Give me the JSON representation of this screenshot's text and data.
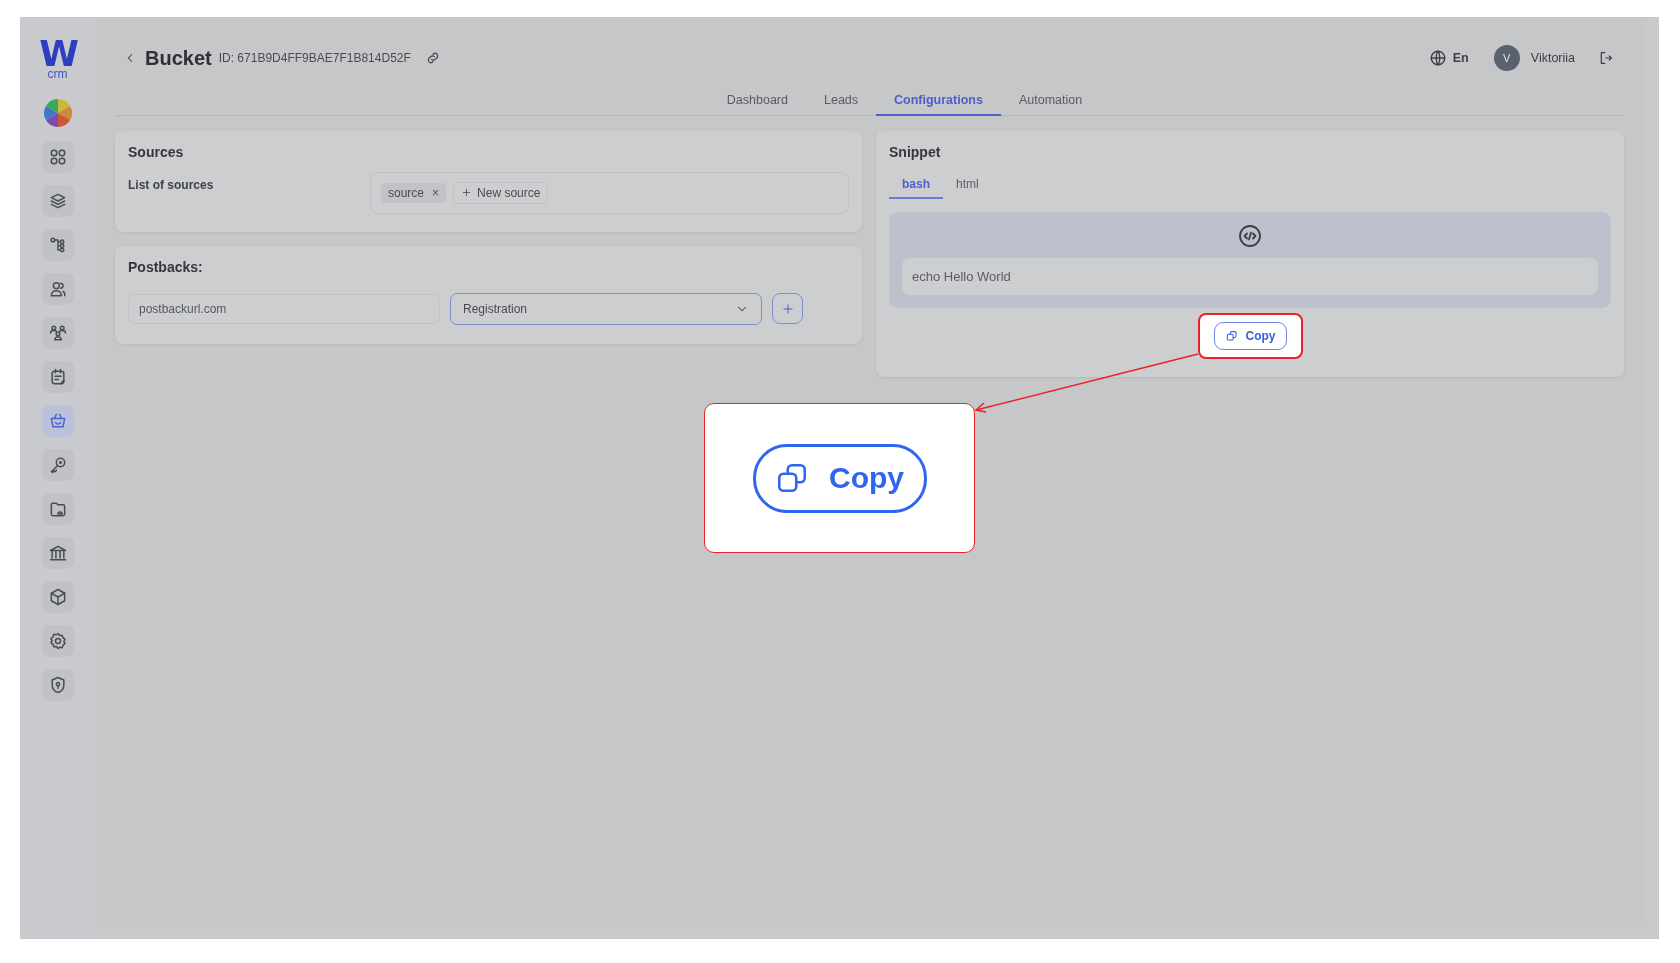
{
  "brand": {
    "logo": "W",
    "logo_sub": "crm"
  },
  "sidebar": {
    "items": [
      {
        "selected": false
      },
      {
        "selected": false
      },
      {
        "selected": false
      },
      {
        "selected": false
      },
      {
        "selected": false
      },
      {
        "selected": false
      },
      {
        "selected": true
      },
      {
        "selected": false
      },
      {
        "selected": false
      },
      {
        "selected": false
      },
      {
        "selected": false
      },
      {
        "selected": false
      },
      {
        "selected": false
      }
    ]
  },
  "header": {
    "title": "Bucket",
    "id": "ID: 671B9D4FF9BAE7F1B814D52F",
    "language": "En",
    "user": {
      "initial": "V",
      "name": "Viktoriia"
    }
  },
  "tabs": [
    {
      "label": "Dashboard",
      "selected": false
    },
    {
      "label": "Leads",
      "selected": false
    },
    {
      "label": "Configurations",
      "selected": true
    },
    {
      "label": "Automation",
      "selected": false
    }
  ],
  "sources": {
    "title": "Sources",
    "label": "List of sources",
    "tags": [
      {
        "label": "source",
        "remove": "×"
      }
    ],
    "add_label": "New source"
  },
  "postbacks": {
    "title": "Postbacks:",
    "url": {
      "placeholder": "postbackurl.com"
    },
    "event": {
      "value": "Registration",
      "focused": true
    }
  },
  "snippet": {
    "title": "Snippet",
    "tabs": [
      {
        "label": "bash",
        "selected": true
      },
      {
        "label": "html",
        "selected": false
      }
    ],
    "code": "echo Hello World",
    "copy_label": "Copy"
  },
  "callout": {
    "copy_label": "Copy"
  }
}
